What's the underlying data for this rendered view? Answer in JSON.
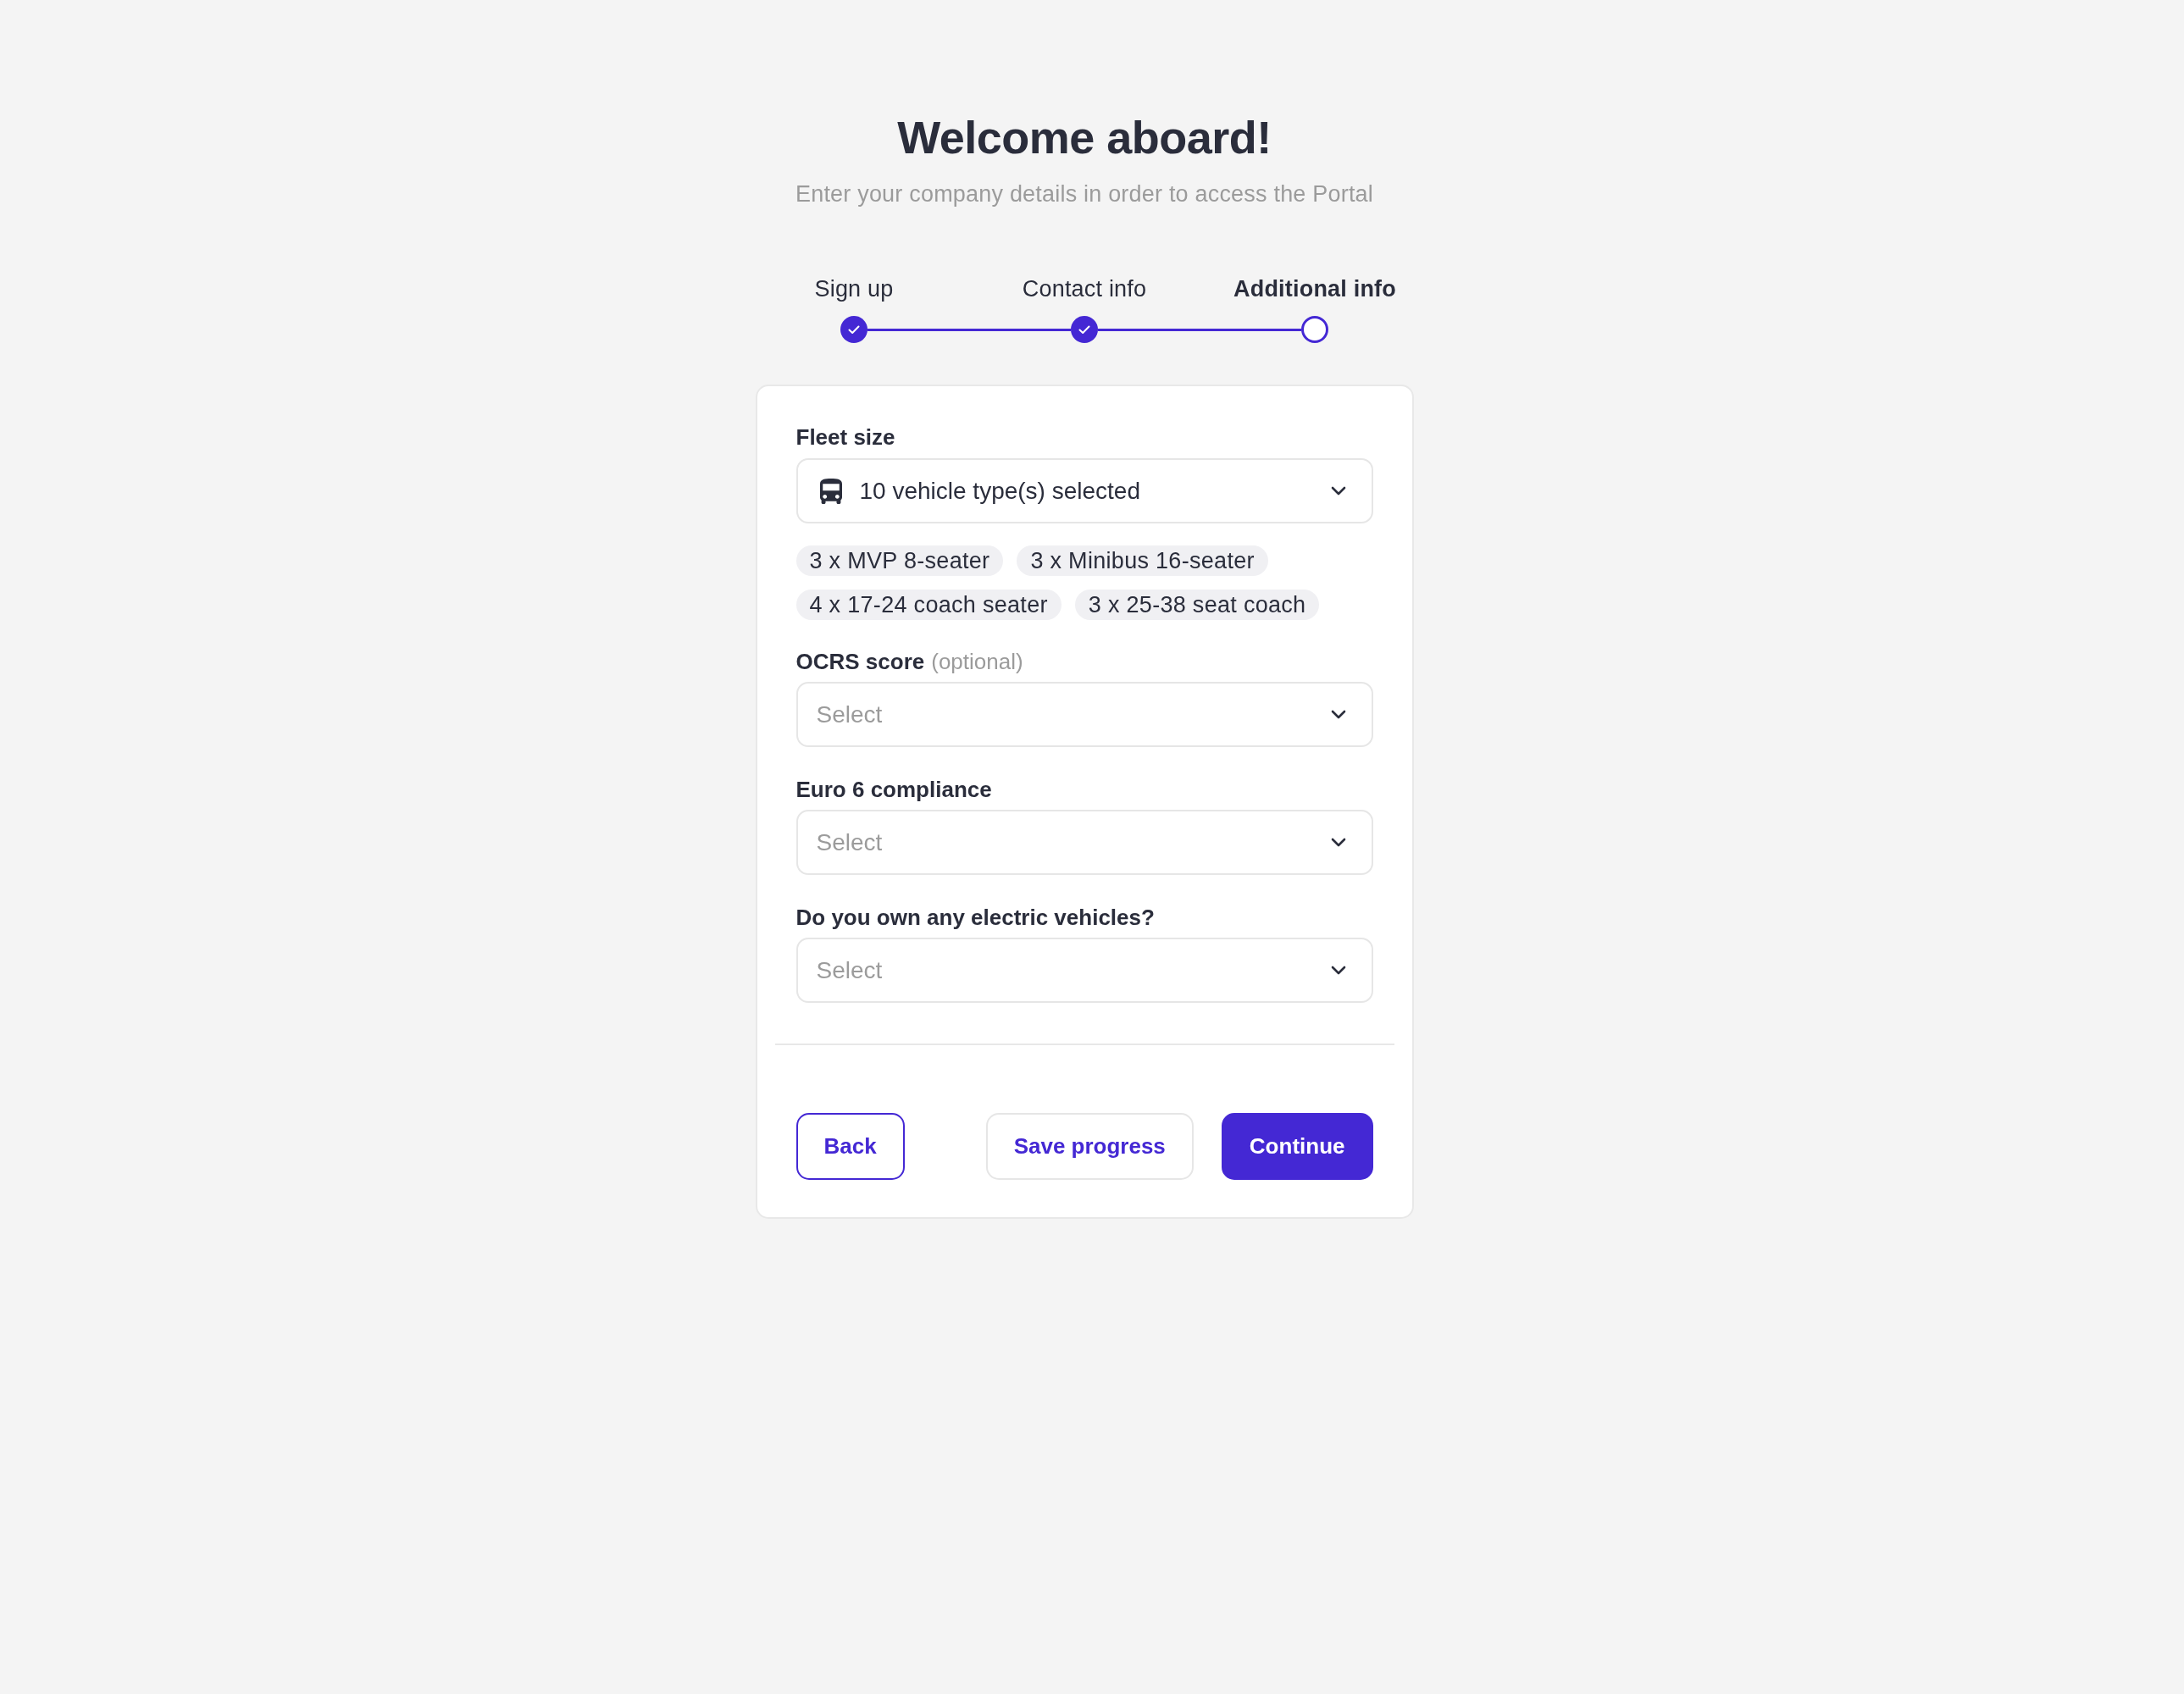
{
  "header": {
    "title": "Welcome aboard!",
    "subtitle": "Enter your company details in order to access the Portal"
  },
  "steps": [
    {
      "label": "Sign up",
      "completed": true,
      "selected": false
    },
    {
      "label": "Contact info",
      "completed": true,
      "selected": false
    },
    {
      "label": "Additional info",
      "completed": false,
      "selected": true
    }
  ],
  "fleet_size": {
    "label": "Fleet size",
    "value": "10 vehicle type(s) selected",
    "chips": [
      "3 x MVP 8-seater",
      "3 x Minibus 16-seater",
      "4 x 17-24 coach seater",
      "3 x 25-38 seat coach"
    ]
  },
  "fields": [
    {
      "label": "OCRS score",
      "hint": "(optional)",
      "placeholder": "Select"
    },
    {
      "label": "Euro 6 compliance",
      "placeholder": "Select"
    },
    {
      "label": "Do you own any electric vehicles?",
      "placeholder": "Select"
    }
  ],
  "buttons": [
    {
      "label": "Back",
      "kind": "outline"
    },
    {
      "label": "Save progress",
      "kind": "secondary"
    },
    {
      "label": "Continue",
      "kind": "primary"
    }
  ]
}
